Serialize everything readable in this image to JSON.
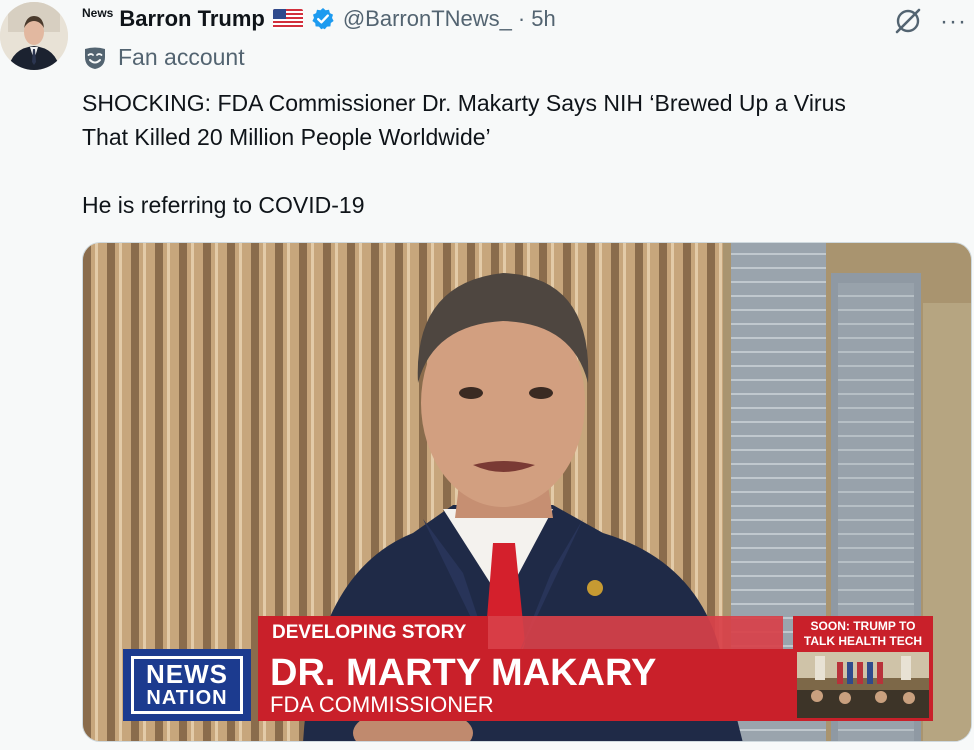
{
  "tweet": {
    "news_mark": "News",
    "display_name": "Barron Trump",
    "handle": "@BarronTNews_",
    "separator": "·",
    "time": "5h",
    "more_glyph": "···",
    "label": "Fan account",
    "text_line_1": "SHOCKING: FDA Commissioner Dr. Makarty Says NIH ‘Brewed Up a Virus",
    "text_line_2": "That Killed 20 Million People Worldwide’",
    "text_line_3": "He is referring to COVID-19"
  },
  "media": {
    "banner": "DEVELOPING STORY",
    "guest_name": "DR. MARTY MAKARY",
    "guest_title": "FDA COMMISSIONER",
    "logo_top": "NEWS",
    "logo_bottom": "NATION",
    "soon_line_1": "SOON: TRUMP TO",
    "soon_line_2": "TALK HEALTH TECH"
  },
  "icons": [
    "flag-us-icon",
    "verified-badge-icon",
    "grok-icon",
    "more-icon",
    "mask-icon"
  ],
  "colors": {
    "verified_blue": "#1d9bf0",
    "secondary_text": "#536471",
    "banner_red": "#c9202a",
    "logo_blue": "#1c3b8f"
  }
}
